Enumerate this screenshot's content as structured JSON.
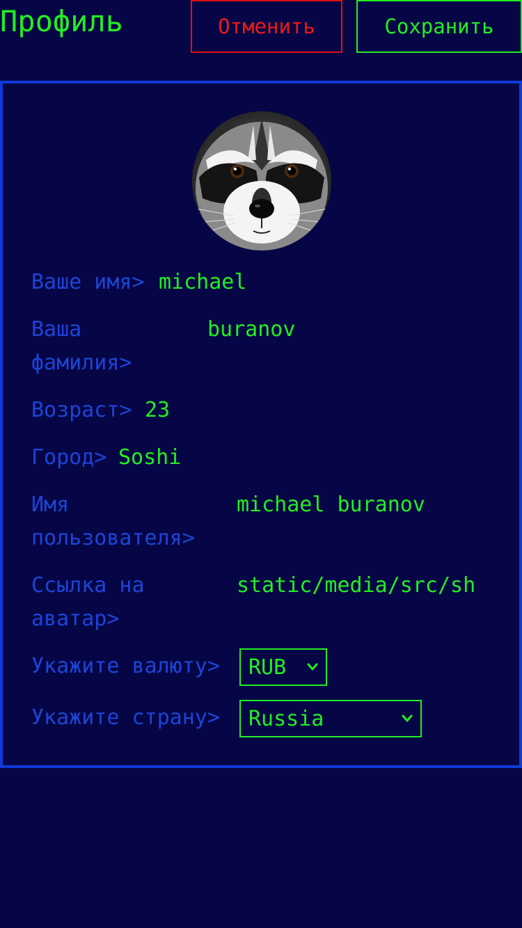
{
  "header": {
    "title": "Профиль",
    "cancel_label": "Отменить",
    "save_label": "Сохранить"
  },
  "colors": {
    "background": "#060646",
    "accent_green": "#22ee22",
    "cancel_red": "#ee1818",
    "label_blue": "#1d44d6",
    "card_border": "#0d3ad8"
  },
  "profile": {
    "avatar_icon": "raccoon-avatar",
    "first_name": {
      "label": "Ваше имя>",
      "value": "michael"
    },
    "last_name": {
      "label": "Ваша\nфамилия>",
      "value": "buranov"
    },
    "age": {
      "label": "Возраст>",
      "value": "23"
    },
    "city": {
      "label": "Город>",
      "value": "Soshi"
    },
    "username": {
      "label": "Имя\nпользователя>",
      "value": "michael buranov"
    },
    "avatar_link": {
      "label": "Ссылка на\nаватар>",
      "value": "static/media/src/sh"
    },
    "currency": {
      "label": "Укажите валюту>",
      "selected": "RUB",
      "icon": "chevron-down-icon"
    },
    "country": {
      "label": "Укажите страну>",
      "selected": "Russia",
      "icon": "chevron-down-icon"
    }
  }
}
